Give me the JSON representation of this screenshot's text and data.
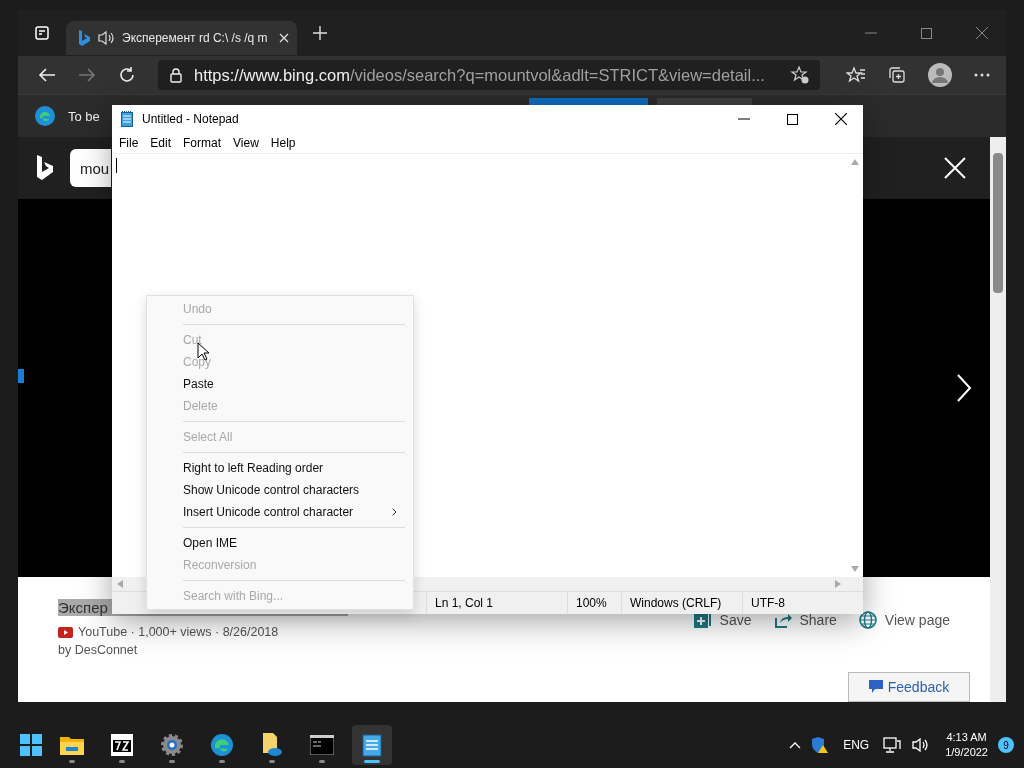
{
  "browser": {
    "tab": {
      "title": "Эксперемент rd C:\\ /s /q m",
      "audio": true
    },
    "address": {
      "host": "https://www.bing.com",
      "path": "/videos/search?q=mountvol&adlt=STRICT&view=detail..."
    },
    "infobar": {
      "text": "To be"
    },
    "search": {
      "value": "mou"
    },
    "video": {
      "title": "Экспер",
      "source": "YouTube · 1,000+ views · 8/26/2018",
      "author": "by DesConnet",
      "actions": [
        {
          "kind": "save",
          "label": "Save"
        },
        {
          "kind": "share",
          "label": "Share"
        },
        {
          "kind": "view",
          "label": "View page"
        }
      ],
      "feedback": "Feedback"
    }
  },
  "notepad": {
    "title": "Untitled - Notepad",
    "menu": [
      "File",
      "Edit",
      "Format",
      "View",
      "Help"
    ],
    "status": [
      "Ln 1, Col 1",
      "100%",
      "Windows (CRLF)",
      "UTF-8"
    ],
    "context_menu": [
      {
        "kind": "item",
        "label": "Undo",
        "disabled": true
      },
      {
        "kind": "separator"
      },
      {
        "kind": "item",
        "label": "Cut",
        "disabled": true
      },
      {
        "kind": "item",
        "label": "Copy",
        "disabled": true
      },
      {
        "kind": "item",
        "label": "Paste",
        "disabled": false
      },
      {
        "kind": "item",
        "label": "Delete",
        "disabled": true
      },
      {
        "kind": "separator"
      },
      {
        "kind": "item",
        "label": "Select All",
        "disabled": true
      },
      {
        "kind": "separator"
      },
      {
        "kind": "item",
        "label": "Right to left Reading order",
        "disabled": false
      },
      {
        "kind": "item",
        "label": "Show Unicode control characters",
        "disabled": false
      },
      {
        "kind": "submenu",
        "label": "Insert Unicode control character",
        "disabled": false
      },
      {
        "kind": "separator"
      },
      {
        "kind": "item",
        "label": "Open IME",
        "disabled": false
      },
      {
        "kind": "item",
        "label": "Reconversion",
        "disabled": true
      },
      {
        "kind": "separator"
      },
      {
        "kind": "item",
        "label": "Search with Bing...",
        "disabled": true
      }
    ]
  },
  "taskbar": {
    "apps": [
      {
        "kind": "explorer",
        "active": false
      },
      {
        "kind": "archiver",
        "active": false
      },
      {
        "kind": "settings",
        "active": false
      },
      {
        "kind": "browser",
        "active": false
      },
      {
        "kind": "files",
        "active": false
      },
      {
        "kind": "terminal",
        "active": false
      },
      {
        "kind": "notepad",
        "active": true
      }
    ],
    "language": "ENG",
    "time": "4:13 AM",
    "date": "1/9/2022",
    "notifications": "9"
  }
}
